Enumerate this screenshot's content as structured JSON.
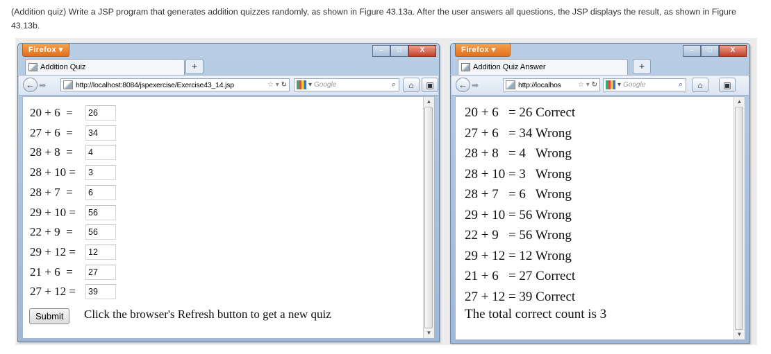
{
  "description": "(Addition quiz) Write a JSP program that generates addition quizzes randomly, as shown in Figure 43.13a. After the user answers all questions, the JSP displays the result, as shown in Figure 43.13b.",
  "browser_menu_label": "Firefox",
  "window_controls": {
    "minimize": "–",
    "maximize": "□",
    "close": "X"
  },
  "quiz_window": {
    "tab_title": "Addition Quiz",
    "new_tab": "+",
    "url": "http://localhost:8084/jspexercise/Exercise43_14.jsp",
    "search_placeholder": "Google",
    "questions": [
      {
        "expr": "20 + 6  =",
        "answer": "26"
      },
      {
        "expr": "27 + 6  =",
        "answer": "34"
      },
      {
        "expr": "28 + 8  =",
        "answer": "4"
      },
      {
        "expr": "28 + 10 =",
        "answer": "3"
      },
      {
        "expr": "28 + 7  =",
        "answer": "6"
      },
      {
        "expr": "29 + 10 =",
        "answer": "56"
      },
      {
        "expr": "22 + 9  =",
        "answer": "56"
      },
      {
        "expr": "29 + 12 =",
        "answer": "12"
      },
      {
        "expr": "21 + 6  =",
        "answer": "27"
      },
      {
        "expr": "27 + 12 =",
        "answer": "39"
      }
    ],
    "submit_label": "Submit",
    "hint": "Click the browser's Refresh button to get a new quiz"
  },
  "answer_window": {
    "tab_title": "Addition Quiz Answer",
    "new_tab": "+",
    "url": "http://localhos",
    "search_placeholder": "Google",
    "results": [
      "20 + 6   = 26 Correct",
      "27 + 6   = 34 Wrong",
      "28 + 8   = 4   Wrong",
      "28 + 10 = 3   Wrong",
      "28 + 7   = 6   Wrong",
      "29 + 10 = 56 Wrong",
      "22 + 9   = 56 Wrong",
      "29 + 12 = 12 Wrong",
      "21 + 6   = 27 Correct",
      "27 + 12 = 39 Correct"
    ],
    "total": "The total correct count is 3"
  }
}
